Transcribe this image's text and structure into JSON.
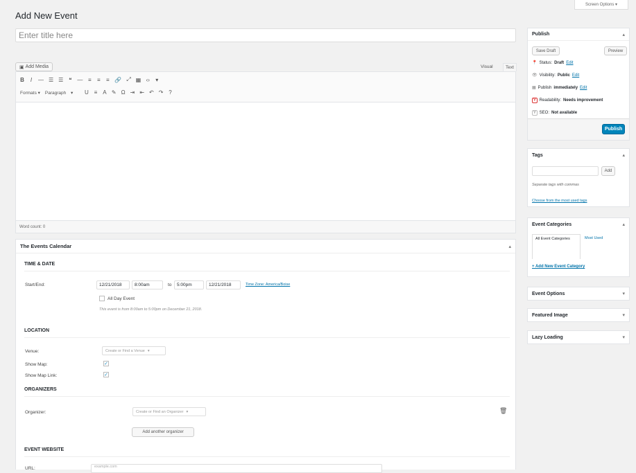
{
  "screen_options": "Screen Options ▾",
  "page_title": "Add New Event",
  "title_input": {
    "placeholder": "Enter title here"
  },
  "editor": {
    "add_media": "Add Media",
    "tab_visual": "Visual",
    "tab_text": "Text",
    "toolbar1": [
      "B",
      "I",
      "—",
      "☰",
      "☰",
      "❝",
      "—",
      "≡",
      "≡",
      "≡",
      "🔗",
      "⤢",
      "▦",
      "‹›",
      "▾"
    ],
    "formats": "Formats ▾",
    "paragraph": "Paragraph",
    "paragraph_arrow": "▾",
    "toolbar2": [
      "U",
      "≡",
      "A",
      "✎",
      "Ω",
      "⇥",
      "⇤",
      "↶",
      "↷",
      "?"
    ],
    "word_count": "Word count: 0"
  },
  "events_calendar": {
    "title": "The Events Calendar",
    "time_date_heading": "TIME & DATE",
    "start_end_label": "Start/End:",
    "start_date": "12/21/2018",
    "start_time": "8:00am",
    "to_text": "to",
    "end_time": "5:00pm",
    "end_date": "12/21/2018",
    "timezone_link": "Time Zone: America/Boise",
    "all_day_label": "All Day Event",
    "summary_text": "This event is from 8:00am to 5:00pm on December 21, 2018.",
    "location_heading": "LOCATION",
    "venue_label": "Venue:",
    "venue_select": "Create or Find a Venue",
    "show_map_label": "Show Map:",
    "show_map_link_label": "Show Map Link:",
    "check_mark": "✓",
    "organizers_heading": "ORGANIZERS",
    "organizer_label": "Organizer:",
    "organizer_select": "Create or Find an Organizer",
    "add_organizer_button": "Add another organizer",
    "event_website_heading": "EVENT WEBSITE",
    "url_label": "URL:",
    "url_placeholder": "example.com"
  },
  "publish_box": {
    "title": "Publish",
    "save_draft": "Save Draft",
    "preview": "Preview",
    "status_label": "Status:",
    "status_value": "Draft",
    "visibility_label": "Visibility:",
    "visibility_value": "Public",
    "publish_label": "Publish",
    "publish_value": "immediately",
    "readability_label": "Readability:",
    "readability_value": "Needs improvement",
    "seo_label": "SEO:",
    "seo_value": "Not available",
    "edit_link": "Edit",
    "publish_button": "Publish"
  },
  "tags_box": {
    "title": "Tags",
    "add_button": "Add",
    "help_text": "Separate tags with commas",
    "choose_link": "Choose from the most used tags"
  },
  "event_categories_box": {
    "title": "Event Categories",
    "tab_all": "All Event Categories",
    "tab_most_used": "Most Used",
    "add_new_link": "+ Add New Event Category"
  },
  "event_options_box": {
    "title": "Event Options"
  },
  "featured_image_box": {
    "title": "Featured Image"
  },
  "lazy_loading_box": {
    "title": "Lazy Loading"
  },
  "colors": {
    "accent": "#0073aa",
    "publish_button": "#0085ba",
    "background": "#f1f1f1",
    "yoast_red": "#dc3232"
  }
}
